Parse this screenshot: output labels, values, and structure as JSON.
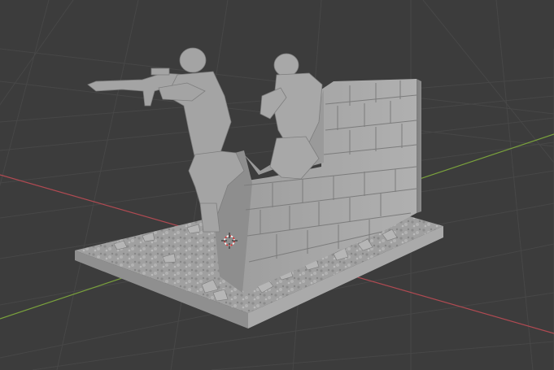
{
  "viewport": {
    "background": "#3c3c3c",
    "grid_color": "#474747",
    "x_axis_color": "#b04a52",
    "y_axis_color": "#7aa23c"
  },
  "scene": {
    "objects": [
      "soldier-aiming-rifle",
      "soldier-crouching-pistol",
      "ruined-brick-wall",
      "rubble-base"
    ],
    "model_color": "#a7a7a7"
  },
  "cursor": {
    "icon": "3d-cursor-icon",
    "colors": [
      "#d83a3a",
      "#ffffff"
    ]
  }
}
